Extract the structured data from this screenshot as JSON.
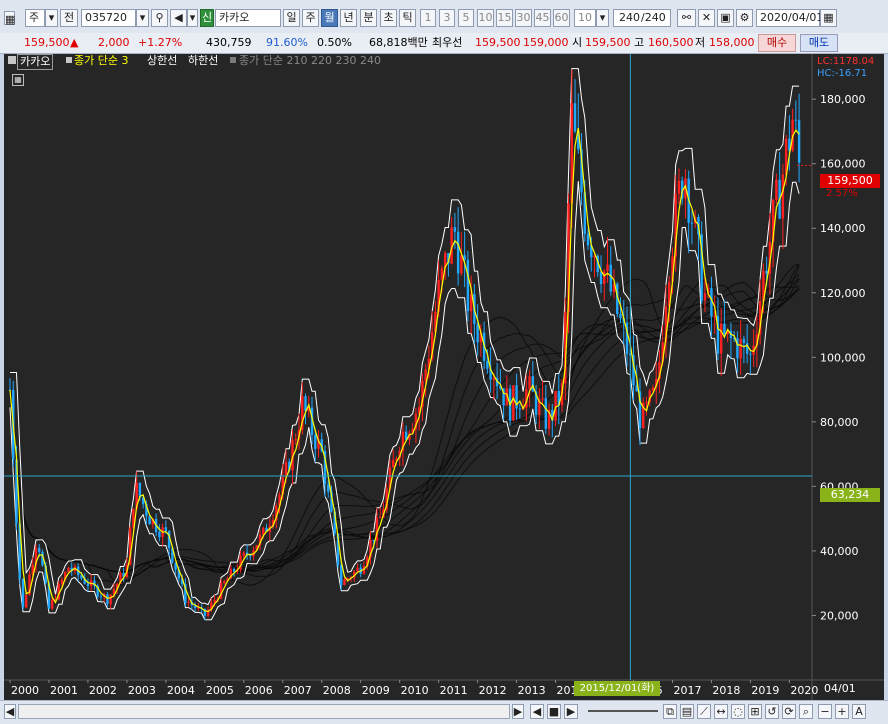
{
  "toolbar": {
    "period_mode": "주",
    "prev_label": "전",
    "stock_code": "035720",
    "badge": "신",
    "stock_name": "카카오",
    "periods": [
      "일",
      "주",
      "월",
      "년"
    ],
    "minute_tick": [
      "분",
      "초",
      "틱"
    ],
    "intervals": [
      "1",
      "3",
      "5",
      "10",
      "15",
      "30",
      "45",
      "60"
    ],
    "interval_custom": "10",
    "count": "240",
    "count_total": "/240",
    "date": "2020/04/01"
  },
  "quote": {
    "price": "159,500",
    "change_arrow": "▲",
    "change": "2,000",
    "change_pct": "+1.27%",
    "volume": "430,759",
    "volume_ratio": "91.60%",
    "turnover": "0.50%",
    "amount": "68,818백만",
    "best_label": "최우선",
    "best_ask": "159,500",
    "best_bid": "159,000",
    "open_label": "시",
    "open": "159,500",
    "high_label": "고",
    "high": "160,500",
    "low_label": "저",
    "low": "158,000",
    "buy_button": "매수",
    "sell_button": "매도"
  },
  "legend": {
    "name": "카카오",
    "ma_label": "종가 단순 3",
    "upper": "상한선",
    "lower": "하한선",
    "ma_multi": "종가 단순 210 220 230 240"
  },
  "chart_data": {
    "type": "candlestick",
    "period": "monthly",
    "x_ticks": [
      "2000",
      "2001",
      "2002",
      "2003",
      "2004",
      "2005",
      "2006",
      "2007",
      "2008",
      "2009",
      "2010",
      "2011",
      "2012",
      "2013",
      "2014",
      "2015",
      "2016",
      "2017",
      "2018",
      "2019",
      "2020"
    ],
    "y_ticks": [
      "180,000",
      "160,000",
      "140,000",
      "120,000",
      "100,000",
      "80,000",
      "60,000",
      "40,000",
      "20,000"
    ],
    "ylim": [
      0,
      194000
    ],
    "lc_label": "LC:1178.04",
    "hc_label": "HC:-16.71",
    "current_price_label": "159,500",
    "current_change_label": "2.57%",
    "crosshair_price_label": "63,234",
    "crosshair_date_label": "2015/12/01(화)",
    "last_date_label": "04/01",
    "series_approx": [
      [
        2000.0,
        90000
      ],
      [
        2000.3,
        20000
      ],
      [
        2000.7,
        45000
      ],
      [
        2001.0,
        22000
      ],
      [
        2001.5,
        35000
      ],
      [
        2002.0,
        30000
      ],
      [
        2002.5,
        25000
      ],
      [
        2003.0,
        35000
      ],
      [
        2003.2,
        60000
      ],
      [
        2003.6,
        50000
      ],
      [
        2004.0,
        45000
      ],
      [
        2004.5,
        25000
      ],
      [
        2005.0,
        20000
      ],
      [
        2005.5,
        30000
      ],
      [
        2006.0,
        38000
      ],
      [
        2006.5,
        45000
      ],
      [
        2007.0,
        60000
      ],
      [
        2007.5,
        85000
      ],
      [
        2008.0,
        70000
      ],
      [
        2008.5,
        30000
      ],
      [
        2009.0,
        35000
      ],
      [
        2009.5,
        50000
      ],
      [
        2010.0,
        75000
      ],
      [
        2010.5,
        85000
      ],
      [
        2011.0,
        120000
      ],
      [
        2011.4,
        140000
      ],
      [
        2011.8,
        115000
      ],
      [
        2012.3,
        100000
      ],
      [
        2012.8,
        85000
      ],
      [
        2013.3,
        90000
      ],
      [
        2013.8,
        80000
      ],
      [
        2014.2,
        90000
      ],
      [
        2014.4,
        175000
      ],
      [
        2014.8,
        140000
      ],
      [
        2015.3,
        125000
      ],
      [
        2015.8,
        105000
      ],
      [
        2016.2,
        80000
      ],
      [
        2016.6,
        90000
      ],
      [
        2016.9,
        130000
      ],
      [
        2017.3,
        160000
      ],
      [
        2017.8,
        120000
      ],
      [
        2018.2,
        105000
      ],
      [
        2018.6,
        105000
      ],
      [
        2019.0,
        100000
      ],
      [
        2019.4,
        130000
      ],
      [
        2019.8,
        155000
      ],
      [
        2020.1,
        175000
      ],
      [
        2020.25,
        159500
      ]
    ]
  },
  "bottom": {
    "zoom_out": "−",
    "zoom_in": "+",
    "auto": "A"
  },
  "colors": {
    "up": "#ff2020",
    "down": "#22a8ff",
    "ma3": "#ffff00",
    "band": "#ffffff",
    "background": "#262626",
    "crosshair": "#2aa7c9",
    "price_tag": "#e00000",
    "cross_tag": "#8ab31a"
  }
}
